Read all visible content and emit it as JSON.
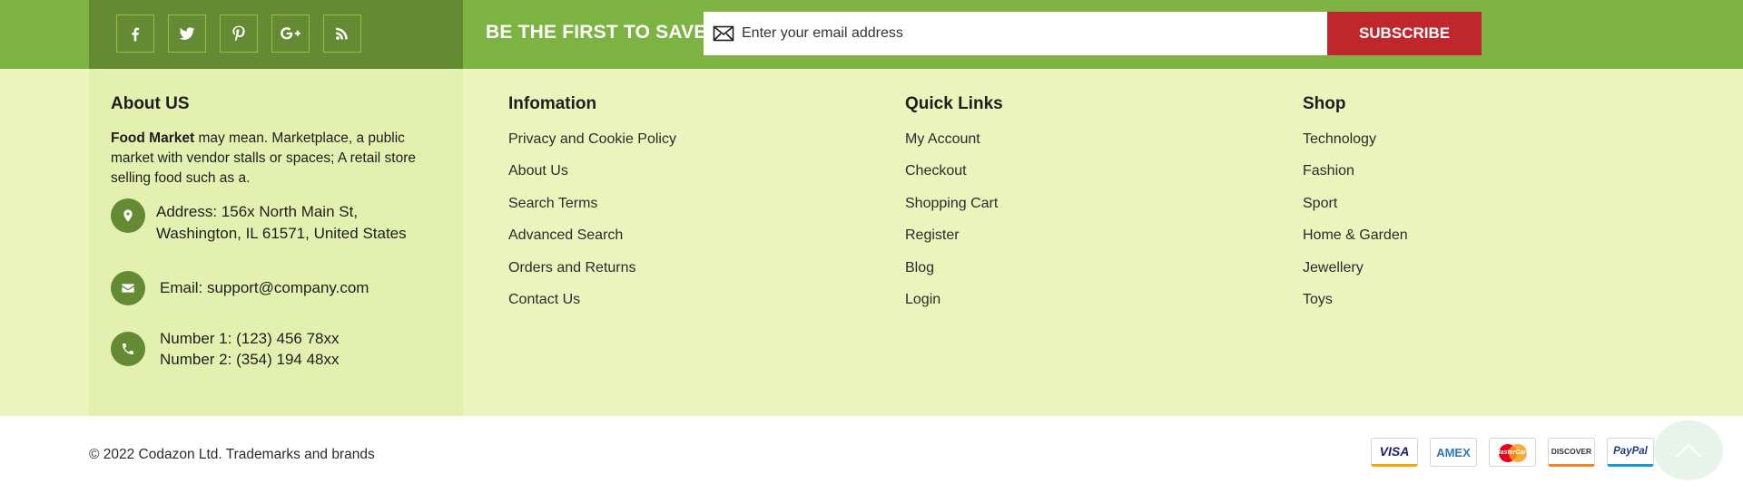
{
  "newsletter": {
    "social": [
      {
        "name": "facebook-icon"
      },
      {
        "name": "twitter-icon"
      },
      {
        "name": "pinterest-icon"
      },
      {
        "name": "google-plus-icon"
      },
      {
        "name": "rss-icon"
      }
    ],
    "headline": "BE THE FIRST TO SAVE!",
    "email_placeholder": "Enter your email address",
    "subscribe_label": "SUBSCRIBE"
  },
  "about": {
    "title": "About US",
    "brand": "Food Market",
    "description": " may mean. Marketplace, a public market with vendor stalls or spaces; A retail store selling food such as a.",
    "address_line1": "Address: 156x North Main St,",
    "address_line2": "Washington, IL 61571, United States",
    "email": "Email: support@company.com",
    "phone1": "Number 1: (123) 456 78xx",
    "phone2": "Number 2: (354) 194 48xx"
  },
  "information": {
    "title": "Infomation",
    "links": [
      "Privacy and Cookie Policy",
      "About Us",
      "Search Terms",
      "Advanced Search",
      "Orders and Returns",
      "Contact Us"
    ]
  },
  "quick_links": {
    "title": "Quick Links",
    "links": [
      "My Account",
      "Checkout",
      "Shopping Cart",
      "Register",
      "Blog",
      "Login"
    ]
  },
  "shop": {
    "title": "Shop",
    "links": [
      "Technology",
      "Fashion",
      "Sport",
      "Home & Garden",
      "Jewellery",
      "Toys"
    ]
  },
  "bottom": {
    "copyright": "© 2022 Codazon Ltd. Trademarks and brands",
    "payments": [
      "VISA",
      "AMEX",
      "MasterCard",
      "DISCOVER",
      "PayPal"
    ]
  },
  "colors": {
    "topbar_green": "#7cb342",
    "dark_green": "#648b33",
    "footer_bg": "#ebf4bd",
    "subscribe_red": "#c0272d"
  }
}
